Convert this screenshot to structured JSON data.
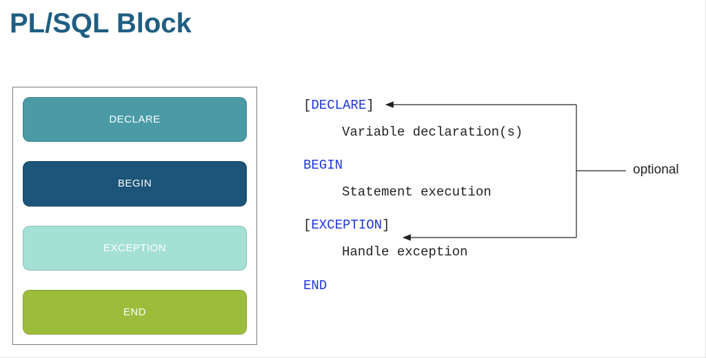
{
  "title": "PL/SQL Block",
  "blocks": {
    "declare": "DECLARE",
    "begin": "BEGIN",
    "exception": "EXCEPTION",
    "end": "END"
  },
  "code": {
    "line1_open": "[",
    "line1_kw": "DECLARE",
    "line1_close": "]",
    "line2": "Variable declaration(s)",
    "line3_kw": "BEGIN",
    "line4": "Statement execution",
    "line5_open": "[",
    "line5_kw": "EXCEPTION",
    "line5_close": "]",
    "line6": "Handle exception",
    "line7_kw": "END"
  },
  "annotation": "optional"
}
